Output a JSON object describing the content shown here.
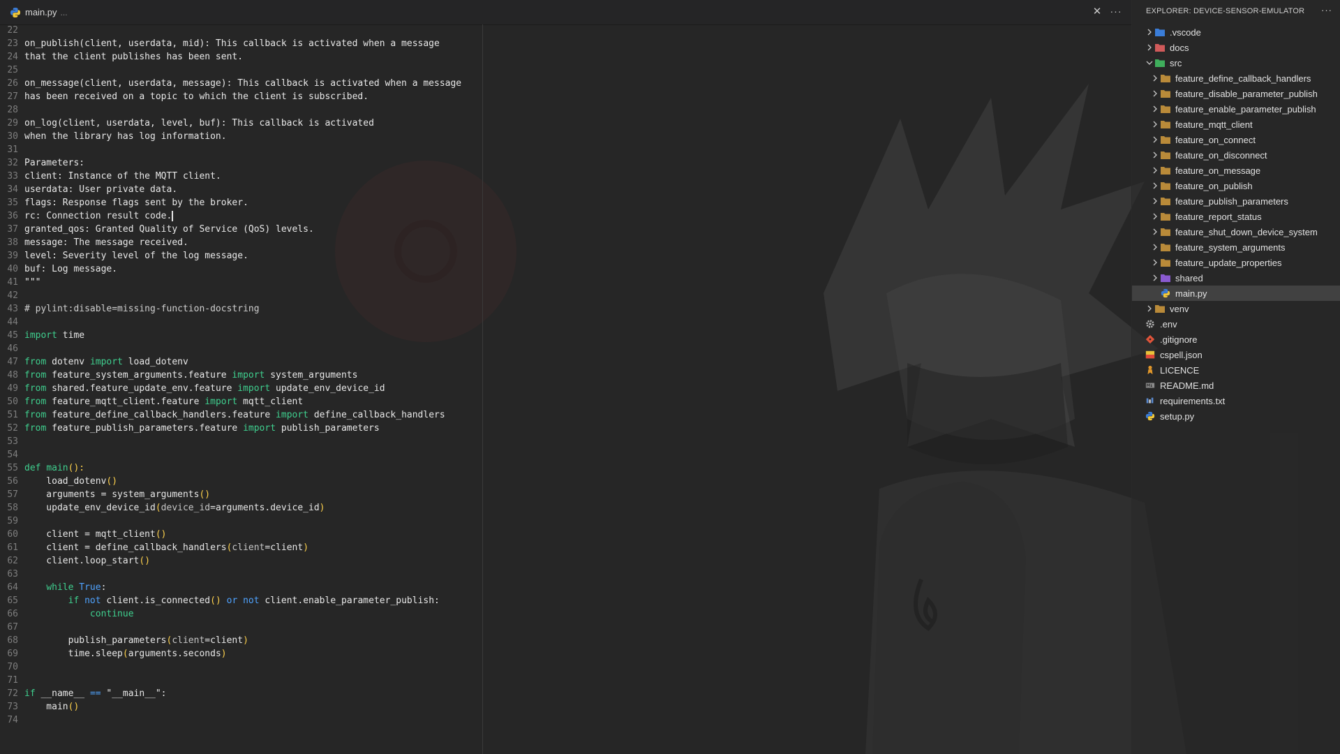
{
  "editor": {
    "tab": {
      "title": "main.py",
      "dirty_marker": "..."
    },
    "close_symbol": "✕",
    "more_symbol": "···",
    "lines": [
      {
        "n": "22",
        "parts": []
      },
      {
        "n": "23",
        "parts": [
          {
            "t": "on_publish(client, userdata, mid): This callback is activated when a message"
          }
        ]
      },
      {
        "n": "24",
        "parts": [
          {
            "t": "that the client publishes has been sent."
          }
        ]
      },
      {
        "n": "25",
        "parts": []
      },
      {
        "n": "26",
        "parts": [
          {
            "t": "on_message(client, userdata, message): This callback is activated when a message"
          }
        ]
      },
      {
        "n": "27",
        "parts": [
          {
            "t": "has been received on a topic to which the client is subscribed."
          }
        ]
      },
      {
        "n": "28",
        "parts": []
      },
      {
        "n": "29",
        "parts": [
          {
            "t": "on_log(client, userdata, level, buf): This callback is activated"
          }
        ]
      },
      {
        "n": "30",
        "parts": [
          {
            "t": "when the library has log information."
          }
        ]
      },
      {
        "n": "31",
        "parts": []
      },
      {
        "n": "32",
        "parts": [
          {
            "t": "Parameters:"
          }
        ]
      },
      {
        "n": "33",
        "parts": [
          {
            "t": "client: Instance of the MQTT client."
          }
        ]
      },
      {
        "n": "34",
        "parts": [
          {
            "t": "userdata: User private data."
          }
        ]
      },
      {
        "n": "35",
        "parts": [
          {
            "t": "flags: Response flags sent by the broker."
          }
        ]
      },
      {
        "n": "36",
        "parts": [
          {
            "t": "rc: Connection result code."
          }
        ],
        "caret": true
      },
      {
        "n": "37",
        "parts": [
          {
            "t": "granted_qos: Granted Quality of Service (QoS) levels."
          }
        ]
      },
      {
        "n": "38",
        "parts": [
          {
            "t": "message: The message received."
          }
        ]
      },
      {
        "n": "39",
        "parts": [
          {
            "t": "level: Severity level of the log message."
          }
        ]
      },
      {
        "n": "40",
        "parts": [
          {
            "t": "buf: Log message."
          }
        ]
      },
      {
        "n": "41",
        "parts": [
          {
            "t": "\"\"\""
          }
        ]
      },
      {
        "n": "42",
        "parts": []
      },
      {
        "n": "43",
        "parts": [
          {
            "t": "# pylint:disable=missing-function-docstring",
            "c": "cm"
          }
        ]
      },
      {
        "n": "44",
        "parts": []
      },
      {
        "n": "45",
        "parts": [
          {
            "t": "import",
            "c": "kw"
          },
          {
            "t": " time"
          }
        ]
      },
      {
        "n": "46",
        "parts": []
      },
      {
        "n": "47",
        "parts": [
          {
            "t": "from",
            "c": "kw"
          },
          {
            "t": " dotenv "
          },
          {
            "t": "import",
            "c": "kw"
          },
          {
            "t": " load_dotenv"
          }
        ]
      },
      {
        "n": "48",
        "parts": [
          {
            "t": "from",
            "c": "kw"
          },
          {
            "t": " feature_system_arguments.feature "
          },
          {
            "t": "import",
            "c": "kw"
          },
          {
            "t": " system_arguments"
          }
        ]
      },
      {
        "n": "49",
        "parts": [
          {
            "t": "from",
            "c": "kw"
          },
          {
            "t": " shared.feature_update_env.feature "
          },
          {
            "t": "import",
            "c": "kw"
          },
          {
            "t": " update_env_device_id"
          }
        ]
      },
      {
        "n": "50",
        "parts": [
          {
            "t": "from",
            "c": "kw"
          },
          {
            "t": " feature_mqtt_client.feature "
          },
          {
            "t": "import",
            "c": "kw"
          },
          {
            "t": " mqtt_client"
          }
        ]
      },
      {
        "n": "51",
        "parts": [
          {
            "t": "from",
            "c": "kw"
          },
          {
            "t": " feature_define_callback_handlers.feature "
          },
          {
            "t": "import",
            "c": "kw"
          },
          {
            "t": " define_callback_handlers"
          }
        ]
      },
      {
        "n": "52",
        "parts": [
          {
            "t": "from",
            "c": "kw"
          },
          {
            "t": " feature_publish_parameters.feature "
          },
          {
            "t": "import",
            "c": "kw"
          },
          {
            "t": " publish_parameters"
          }
        ]
      },
      {
        "n": "53",
        "parts": []
      },
      {
        "n": "54",
        "parts": []
      },
      {
        "n": "55",
        "parts": [
          {
            "t": "def",
            "c": "kw"
          },
          {
            "t": " "
          },
          {
            "t": "main",
            "c": "kw"
          },
          {
            "t": "():",
            "c": "br"
          }
        ]
      },
      {
        "n": "56",
        "parts": [
          {
            "t": "    load_dotenv"
          },
          {
            "t": "()",
            "c": "br"
          }
        ]
      },
      {
        "n": "57",
        "parts": [
          {
            "t": "    arguments = system_arguments"
          },
          {
            "t": "()",
            "c": "br"
          }
        ]
      },
      {
        "n": "58",
        "parts": [
          {
            "t": "    update_env_device_id"
          },
          {
            "t": "(",
            "c": "br"
          },
          {
            "t": "device_id",
            "c": "pm"
          },
          {
            "t": "=arguments.device_id"
          },
          {
            "t": ")",
            "c": "br"
          }
        ]
      },
      {
        "n": "59",
        "parts": []
      },
      {
        "n": "60",
        "parts": [
          {
            "t": "    client = mqtt_client"
          },
          {
            "t": "()",
            "c": "br"
          }
        ]
      },
      {
        "n": "61",
        "parts": [
          {
            "t": "    client = define_callback_handlers"
          },
          {
            "t": "(",
            "c": "br"
          },
          {
            "t": "client",
            "c": "pm"
          },
          {
            "t": "=client"
          },
          {
            "t": ")",
            "c": "br"
          }
        ]
      },
      {
        "n": "62",
        "parts": [
          {
            "t": "    client.loop_start"
          },
          {
            "t": "()",
            "c": "br"
          }
        ]
      },
      {
        "n": "63",
        "parts": []
      },
      {
        "n": "64",
        "parts": [
          {
            "t": "    "
          },
          {
            "t": "while",
            "c": "kw"
          },
          {
            "t": " "
          },
          {
            "t": "True",
            "c": "kw2"
          },
          {
            "t": ":"
          }
        ]
      },
      {
        "n": "65",
        "parts": [
          {
            "t": "        "
          },
          {
            "t": "if",
            "c": "kw"
          },
          {
            "t": " "
          },
          {
            "t": "not",
            "c": "kw2"
          },
          {
            "t": " client.is_connected"
          },
          {
            "t": "()",
            "c": "br"
          },
          {
            "t": " "
          },
          {
            "t": "or",
            "c": "kw2"
          },
          {
            "t": " "
          },
          {
            "t": "not",
            "c": "kw2"
          },
          {
            "t": " client.enable_parameter_publish:"
          }
        ]
      },
      {
        "n": "66",
        "parts": [
          {
            "t": "            "
          },
          {
            "t": "continue",
            "c": "kw"
          }
        ]
      },
      {
        "n": "67",
        "parts": []
      },
      {
        "n": "68",
        "parts": [
          {
            "t": "        publish_parameters"
          },
          {
            "t": "(",
            "c": "br"
          },
          {
            "t": "client",
            "c": "pm"
          },
          {
            "t": "=client"
          },
          {
            "t": ")",
            "c": "br"
          }
        ]
      },
      {
        "n": "69",
        "parts": [
          {
            "t": "        time.sleep"
          },
          {
            "t": "(",
            "c": "br"
          },
          {
            "t": "arguments.seconds"
          },
          {
            "t": ")",
            "c": "br"
          }
        ]
      },
      {
        "n": "70",
        "parts": []
      },
      {
        "n": "71",
        "parts": []
      },
      {
        "n": "72",
        "parts": [
          {
            "t": "if",
            "c": "kw"
          },
          {
            "t": " __name__ "
          },
          {
            "t": "==",
            "c": "kw2"
          },
          {
            "t": " \"__main__\":"
          }
        ]
      },
      {
        "n": "73",
        "parts": [
          {
            "t": "    main"
          },
          {
            "t": "()",
            "c": "br"
          }
        ]
      },
      {
        "n": "74",
        "parts": []
      }
    ]
  },
  "explorer": {
    "title": "EXPLORER: DEVICE-SENSOR-EMULATOR",
    "more_symbol": "···",
    "items": [
      {
        "label": ".vscode",
        "depth": 0,
        "chevron": "right",
        "icon": "vscode-folder",
        "color": "#3b7dd8"
      },
      {
        "label": "docs",
        "depth": 0,
        "chevron": "right",
        "icon": "docs-folder",
        "color": "#d05a5a"
      },
      {
        "label": "src",
        "depth": 0,
        "chevron": "down",
        "icon": "src-folder",
        "color": "#3fae5c"
      },
      {
        "label": "feature_define_callback_handlers",
        "depth": 1,
        "chevron": "right",
        "icon": "folder",
        "color": "#b88a3a"
      },
      {
        "label": "feature_disable_parameter_publish",
        "depth": 1,
        "chevron": "right",
        "icon": "folder",
        "color": "#b88a3a"
      },
      {
        "label": "feature_enable_parameter_publish",
        "depth": 1,
        "chevron": "right",
        "icon": "folder",
        "color": "#b88a3a"
      },
      {
        "label": "feature_mqtt_client",
        "depth": 1,
        "chevron": "right",
        "icon": "folder",
        "color": "#b88a3a"
      },
      {
        "label": "feature_on_connect",
        "depth": 1,
        "chevron": "right",
        "icon": "folder",
        "color": "#b88a3a"
      },
      {
        "label": "feature_on_disconnect",
        "depth": 1,
        "chevron": "right",
        "icon": "folder",
        "color": "#b88a3a"
      },
      {
        "label": "feature_on_message",
        "depth": 1,
        "chevron": "right",
        "icon": "folder",
        "color": "#b88a3a"
      },
      {
        "label": "feature_on_publish",
        "depth": 1,
        "chevron": "right",
        "icon": "folder",
        "color": "#b88a3a"
      },
      {
        "label": "feature_publish_parameters",
        "depth": 1,
        "chevron": "right",
        "icon": "folder",
        "color": "#b88a3a"
      },
      {
        "label": "feature_report_status",
        "depth": 1,
        "chevron": "right",
        "icon": "folder",
        "color": "#b88a3a"
      },
      {
        "label": "feature_shut_down_device_system",
        "depth": 1,
        "chevron": "right",
        "icon": "folder",
        "color": "#b88a3a"
      },
      {
        "label": "feature_system_arguments",
        "depth": 1,
        "chevron": "right",
        "icon": "folder",
        "color": "#b88a3a"
      },
      {
        "label": "feature_update_properties",
        "depth": 1,
        "chevron": "right",
        "icon": "folder",
        "color": "#b88a3a"
      },
      {
        "label": "shared",
        "depth": 1,
        "chevron": "right",
        "icon": "shared-folder",
        "color": "#8a5ad0"
      },
      {
        "label": "main.py",
        "depth": 1,
        "chevron": "none",
        "icon": "python-file",
        "color": "#3b7dd8",
        "selected": true
      },
      {
        "label": "venv",
        "depth": 0,
        "chevron": "right",
        "icon": "folder",
        "color": "#b88a3a"
      },
      {
        "label": ".env",
        "depth": 0,
        "chevron": "none",
        "icon": "gear",
        "color": "#b0b0b0"
      },
      {
        "label": ".gitignore",
        "depth": 0,
        "chevron": "none",
        "icon": "git",
        "color": "#e0543a"
      },
      {
        "label": "cspell.json",
        "depth": 0,
        "chevron": "none",
        "icon": "json",
        "color": "#e8c23a"
      },
      {
        "label": "LICENCE",
        "depth": 0,
        "chevron": "none",
        "icon": "license",
        "color": "#e0962a"
      },
      {
        "label": "README.md",
        "depth": 0,
        "chevron": "none",
        "icon": "markdown",
        "color": "#8a8a8a"
      },
      {
        "label": "requirements.txt",
        "depth": 0,
        "chevron": "none",
        "icon": "text-file",
        "color": "#5a8ad0"
      },
      {
        "label": "setup.py",
        "depth": 0,
        "chevron": "none",
        "icon": "python-file",
        "color": "#3b7dd8"
      }
    ]
  }
}
